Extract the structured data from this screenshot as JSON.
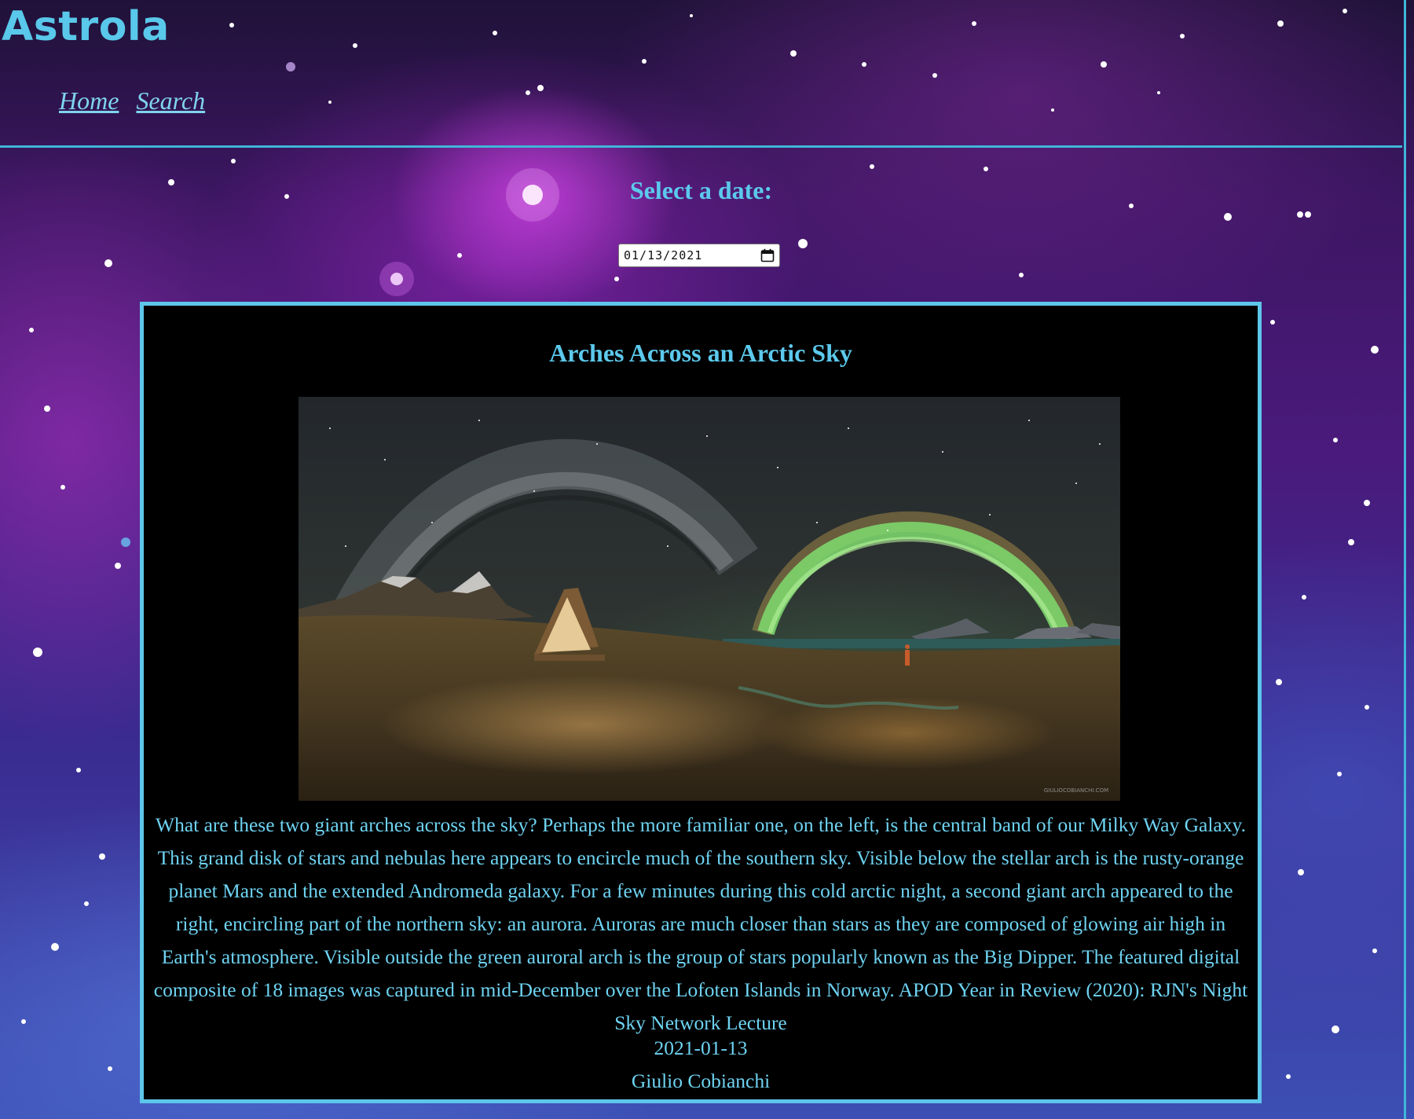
{
  "app": {
    "brand": "Astrola"
  },
  "nav": {
    "items": [
      {
        "label": "Home"
      },
      {
        "label": "Search"
      }
    ]
  },
  "date_picker": {
    "label": "Select a date:",
    "value": "01/13/2021"
  },
  "apod": {
    "title": "Arches Across an Arctic Sky",
    "explanation": "What are these two giant arches across the sky? Perhaps the more familiar one, on the left, is the central band of our Milky Way Galaxy. This grand disk of stars and nebulas here appears to encircle much of the southern sky. Visible below the stellar arch is the rusty-orange planet Mars and the extended Andromeda galaxy. For a few minutes during this cold arctic night, a second giant arch appeared to the right, encircling part of the northern sky: an aurora. Auroras are much closer than stars as they are composed of glowing air high in Earth's atmosphere. Visible outside the green auroral arch is the group of stars popularly known as the Big Dipper. The featured digital composite of 18 images was captured in mid-December over the Lofoten Islands in Norway. APOD Year in Review (2020): RJN's Night Sky Network Lecture",
    "date": "2021-01-13",
    "copyright": "Giulio Cobianchi",
    "photo_watermark": "GIULIOCOBIANCHI.COM"
  },
  "colors": {
    "accent": "#5cc9ec",
    "card_background": "#000000",
    "card_border": "#5ec6ea"
  }
}
